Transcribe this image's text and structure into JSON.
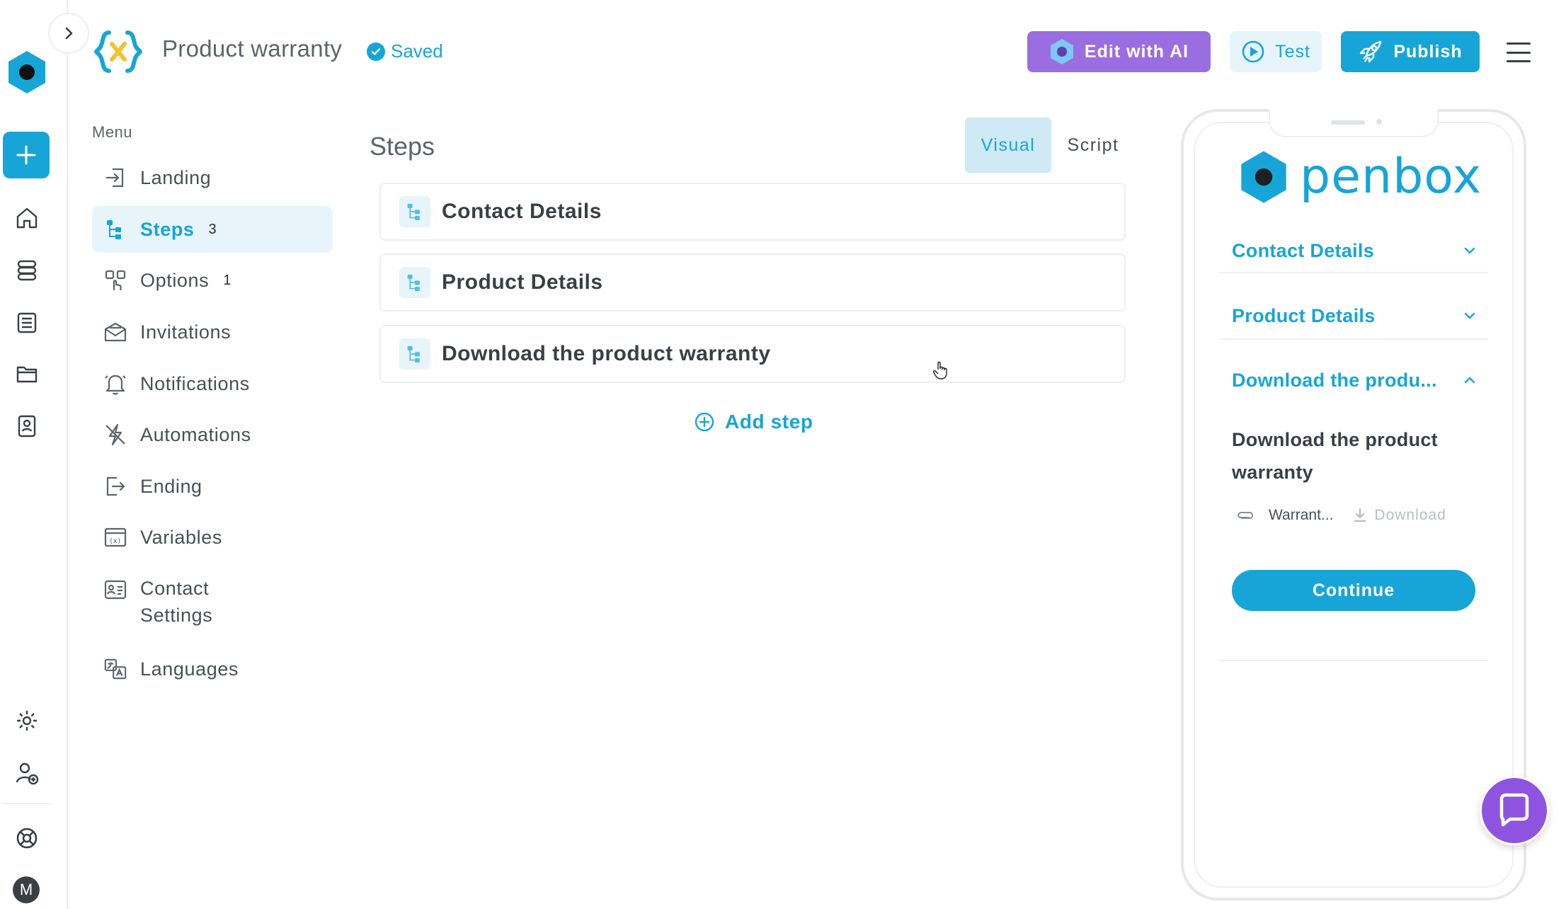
{
  "header": {
    "title": "Product warranty",
    "saved_label": "Saved",
    "edit_ai_label": "Edit with AI",
    "test_label": "Test",
    "publish_label": "Publish"
  },
  "rail": {
    "avatar_initial": "M"
  },
  "menu": {
    "title": "Menu",
    "items": [
      {
        "label": "Landing",
        "icon": "login-icon"
      },
      {
        "label": "Steps",
        "icon": "steps-icon",
        "count": "3",
        "active": true
      },
      {
        "label": "Options",
        "icon": "options-icon",
        "count": "1"
      },
      {
        "label": "Invitations",
        "icon": "envelope-icon"
      },
      {
        "label": "Notifications",
        "icon": "bell-icon"
      },
      {
        "label": "Automations",
        "icon": "lightning-icon"
      },
      {
        "label": "Ending",
        "icon": "logout-icon"
      },
      {
        "label": "Variables",
        "icon": "variable-icon"
      },
      {
        "label": "Contact Settings",
        "icon": "contact-card-icon"
      },
      {
        "label": "Languages",
        "icon": "languages-icon"
      }
    ]
  },
  "steps": {
    "title": "Steps",
    "view_visual": "Visual",
    "view_script": "Script",
    "items": [
      {
        "label": "Contact Details"
      },
      {
        "label": "Product Details"
      },
      {
        "label": "Download the product warranty"
      }
    ],
    "add_label": "Add step"
  },
  "preview": {
    "brand": "penbox",
    "accordions": [
      {
        "label": "Contact Details",
        "expanded": false
      },
      {
        "label": "Product Details",
        "expanded": false
      },
      {
        "label": "Download the produ...",
        "expanded": true
      }
    ],
    "heading": "Download the product warranty",
    "file_name": "Warrant...",
    "download_label": "Download",
    "continue_label": "Continue"
  },
  "colors": {
    "accent": "#17a5d8",
    "ai_purple": "#9a6ee0",
    "chat_purple": "#8e54e0",
    "text": "#3a3f45"
  }
}
